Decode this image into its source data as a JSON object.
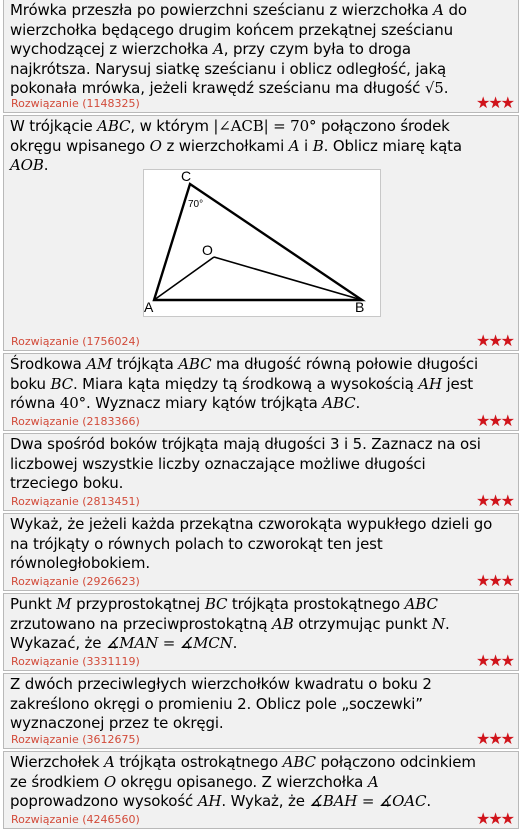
{
  "problems": [
    {
      "line1": "Mrówka przeszła po powierzchni sześcianu z wierzchołka ",
      "A": "A",
      "line1b": " do",
      "line2": "wierzchołka będącego drugim końcem przekątnej sześcianu",
      "line3a": "wychodzącej z wierzchołka ",
      "A2": "A",
      "line3b": ", przy czym była to droga",
      "line4": "najkrótsza. Narysuj siatkę sześcianu i oblicz odległość, jaką",
      "line5": "pokonała mrówka, jeżeli krawędź sześcianu ma długość ",
      "sqrt": "√5",
      "end": ".",
      "solution": "Rozwiązanie (1148325)",
      "stars": "★★★"
    },
    {
      "line1a": "W trójkącie ",
      "ABC": "ABC",
      "line1b": ", w którym ",
      "angle": "|∠ACB| = 70°",
      "line1c": " połączono środek",
      "line2a": "okręgu wpisanego ",
      "O": "O",
      "line2b": " z wierzchołkami ",
      "A": "A",
      "line2c": " i ",
      "B": "B",
      "line2d": ". Oblicz miarę kąta",
      "AOB": "AOB",
      "end": ".",
      "figure": {
        "C": "C",
        "A": "A",
        "B": "B",
        "O": "O",
        "angle_label": "70°"
      },
      "solution": "Rozwiązanie (1756024)",
      "stars": "★★★"
    },
    {
      "p1a": "Środkowa ",
      "AM": "AM",
      "p1b": " trójkąta ",
      "ABC": "ABC",
      "p1c": " ma długość równą połowie długości",
      "p2a": "boku ",
      "BC": "BC",
      "p2b": ". Miara kąta między tą środkową a wysokością ",
      "AH": "AH",
      "p2c": " jest",
      "p3a": "równa ",
      "deg": "40°",
      "p3b": ". Wyznacz miary kątów trójkąta ",
      "ABC2": "ABC",
      "end": ".",
      "solution": "Rozwiązanie (2183366)",
      "stars": "★★★"
    },
    {
      "l1": "Dwa spośród boków trójkąta mają długości 3 i 5. Zaznacz na osi",
      "l2": "liczbowej wszystkie liczby oznaczające możliwe długości",
      "l3": "trzeciego boku.",
      "solution": "Rozwiązanie (2813451)",
      "stars": "★★★"
    },
    {
      "l1": "Wykaż, że jeżeli każda przekątna czworokąta wypukłego dzieli go",
      "l2": "na trójkąty o równych polach to czworokąt ten jest",
      "l3": "równoległobokiem.",
      "solution": "Rozwiązanie (2926623)",
      "stars": "★★★"
    },
    {
      "p1a": "Punkt ",
      "M": "M",
      "p1b": " przyprostokątnej ",
      "BC": "BC",
      "p1c": " trójkąta prostokątnego ",
      "ABC": "ABC",
      "p2a": "zrzutowano na przeciwprostokątną ",
      "AB": "AB",
      "p2b": " otrzymując punkt ",
      "N": "N",
      "p2c": ".",
      "p3a": "Wykazać, że ",
      "eq": "∡MAN = ∡MCN",
      "end": ".",
      "solution": "Rozwiązanie (3331119)",
      "stars": "★★★"
    },
    {
      "l1": "Z dwóch przeciwległych wierzchołków kwadratu o boku 2",
      "l2": "zakreślono okręgi o promieniu 2. Oblicz pole „soczewki”",
      "l3": "wyznaczonej przez te okręgi.",
      "solution": "Rozwiązanie (3612675)",
      "stars": "★★★"
    },
    {
      "p1a": "Wierzchołek ",
      "A": "A",
      "p1b": " trójkąta ostrokątnego ",
      "ABC": "ABC",
      "p1c": " połączono odcinkiem",
      "p2a": "ze środkiem ",
      "O": "O",
      "p2b": " okręgu opisanego. Z wierzchołka ",
      "A2": "A",
      "p3a": "poprowadzono wysokość ",
      "AH": "AH",
      "p3b": ". Wykaż, że ",
      "eq": "∡BAH = ∡OAC",
      "end": ".",
      "solution": "Rozwiązanie (4246560)",
      "stars": "★★★"
    }
  ]
}
